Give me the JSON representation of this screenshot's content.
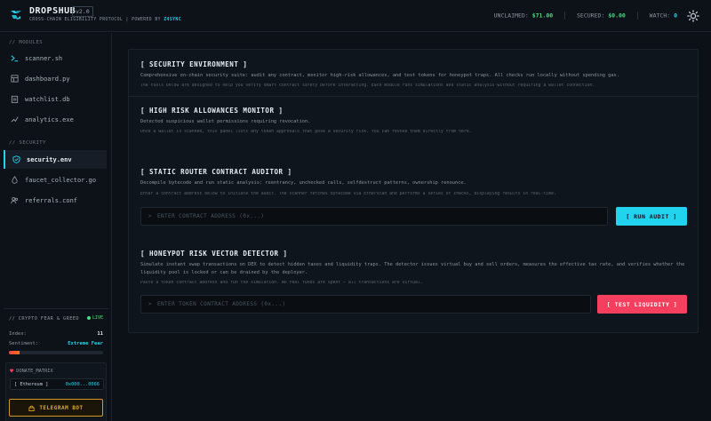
{
  "header": {
    "brand": "DROPSHUB",
    "version": "v2.0",
    "subtitle_prefix": "CROSS-CHAIN ELIGIBILITY PROTOCOL  |  POWERED BY",
    "subtitle_accent": "Z4SYNC",
    "stats": {
      "unclaimed_label": "UNCLAIMED:",
      "unclaimed_value": "$71.00",
      "secured_label": "SECURED:",
      "secured_value": "$0.00",
      "watch_label": "WATCH:",
      "watch_value": "0"
    },
    "icons": {
      "logo": "dropshub-logo-icon",
      "theme": "sun-icon"
    }
  },
  "sidebar": {
    "modules_label": "// MODULES",
    "security_label": "// SECURITY",
    "modules": [
      {
        "label": "scanner.sh",
        "icon": "terminal-icon"
      },
      {
        "label": "dashboard.py",
        "icon": "grid-icon"
      },
      {
        "label": "watchlist.db",
        "icon": "clipboard-icon"
      },
      {
        "label": "analytics.exe",
        "icon": "chart-icon"
      }
    ],
    "security": [
      {
        "label": "security.env",
        "icon": "shield-icon",
        "active": true
      },
      {
        "label": "faucet_collector.go",
        "icon": "drop-icon"
      },
      {
        "label": "referrals.conf",
        "icon": "users-icon"
      }
    ],
    "fear_greed": {
      "title": "// CRYPTO FEAR & GREED",
      "live": "LIVE",
      "index_label": "Index:",
      "index_value": "11",
      "sentiment_label": "Sentiment:",
      "sentiment_value": "Extreme Fear",
      "level_percent": 11,
      "colors": {
        "start": "#ef4444",
        "end": "#f97316"
      }
    },
    "donate": {
      "title": "DONATE_MATRIX",
      "network": "[ Ethereum ]",
      "address": "0x000...0066"
    },
    "telegram_button": "TELEGRAM BOT"
  },
  "main": {
    "security_env": {
      "title": "[ SECURITY ENVIRONMENT ]",
      "desc": "Comprehensive on-chain security suite: audit any contract, monitor high-risk allowances, and test tokens for honeypot traps. All checks run locally without spending gas.",
      "note": "The tools below are designed to help you verify smart contract safety before interacting. Each module runs simulations and static analysis without requiring a wallet connection."
    },
    "allowances": {
      "title": "[ HIGH RISK ALLOWANCES MONITOR ]",
      "desc": "Detected suspicious wallet permissions requiring revocation.",
      "note": "Once a wallet is scanned, this panel lists any token approvals that pose a security risk. You can revoke them directly from here."
    },
    "auditor": {
      "title": "[ STATIC ROUTER CONTRACT AUDITOR ]",
      "desc": "Decompile bytecode and run static analysis: reentrancy, unchecked calls, selfdestruct patterns, ownership renounce.",
      "note": "Enter a contract address below to initiate the audit. The scanner fetches bytecode via Etherscan and performs a series of checks, displaying results in real-time.",
      "placeholder": "ENTER CONTRACT ADDRESS (0x...)",
      "button": "[ RUN AUDIT ]"
    },
    "honeypot": {
      "title": "[ HONEYPOT RISK VECTOR DETECTOR ]",
      "desc": "Simulate instant swap transactions on DEX to detect hidden taxes and liquidity traps. The detector issues virtual buy and sell orders, measures the effective tax rate, and verifies whether the liquidity pool is locked or can be drained by the deployer.",
      "note": "Paste a token contract address and run the simulation. No real funds are spent — all transactions are virtual.",
      "placeholder": "ENTER TOKEN CONTRACT ADDRESS (0x...)",
      "button": "[ TEST LIQUIDITY ]"
    }
  },
  "colors": {
    "accent": "#22d3ee",
    "danger": "#f43f5e",
    "success": "#4ade80",
    "warning": "#e3a82b"
  }
}
